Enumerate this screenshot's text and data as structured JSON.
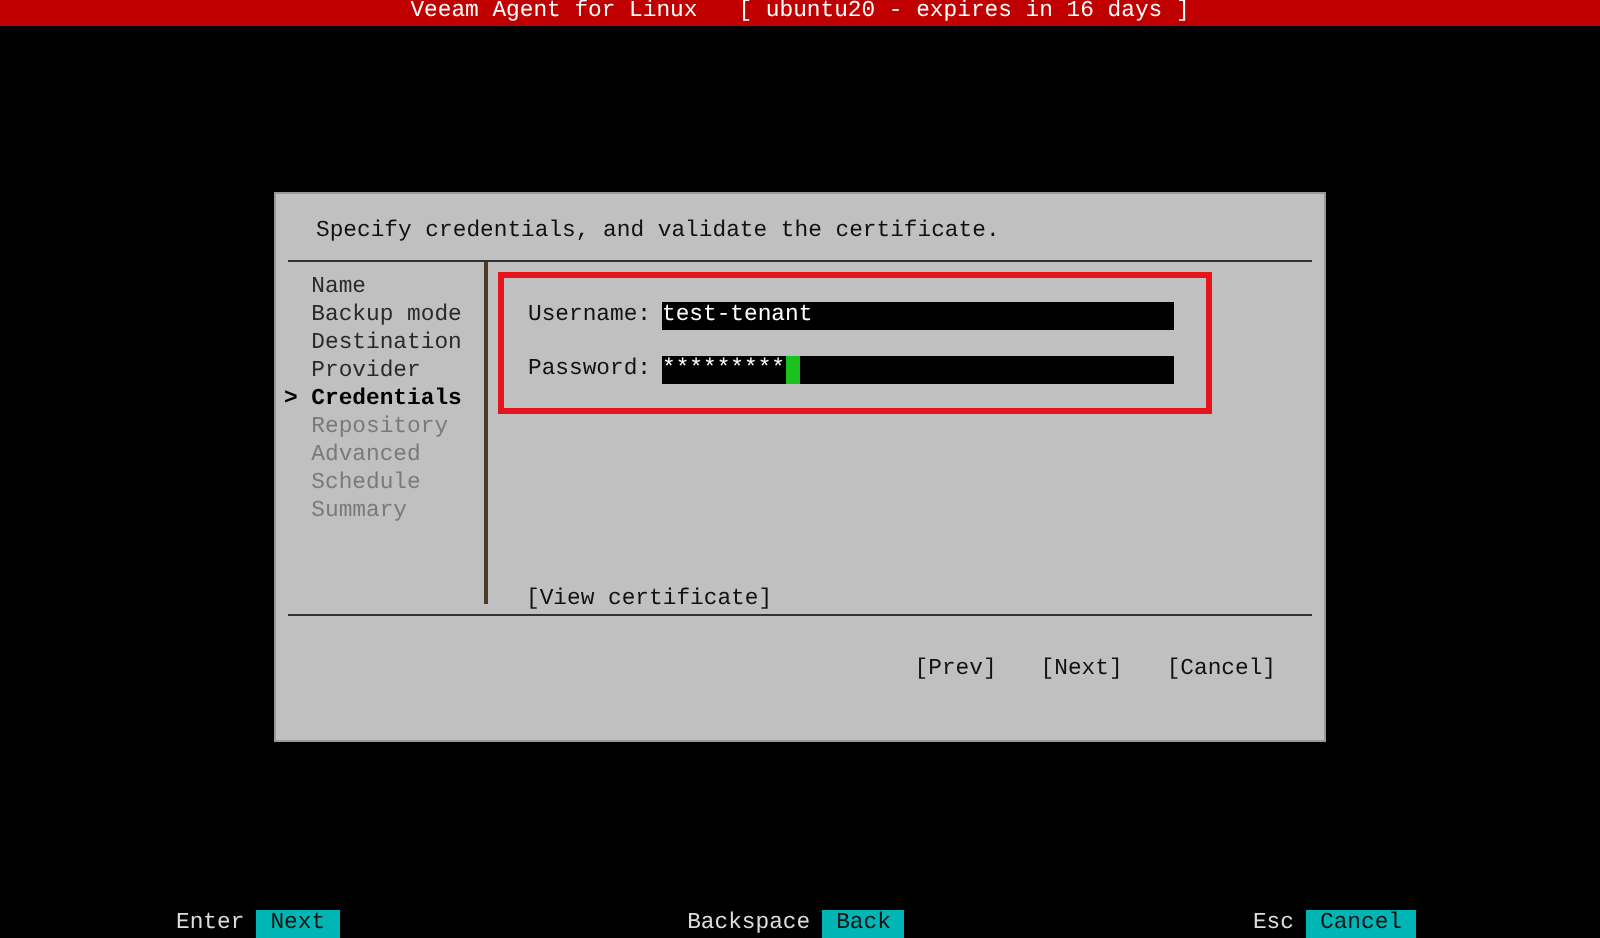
{
  "title_bar": {
    "title": "Veeam Agent for Linux   [ ubuntu20 - expires in 16 days ]"
  },
  "dialog": {
    "instruction": "Specify credentials, and validate the certificate.",
    "step_cursor": ">",
    "steps": [
      {
        "label": "Name",
        "selected": false,
        "disabled": false
      },
      {
        "label": "Backup mode",
        "selected": false,
        "disabled": false
      },
      {
        "label": "Destination",
        "selected": false,
        "disabled": false
      },
      {
        "label": "Provider",
        "selected": false,
        "disabled": false
      },
      {
        "label": "Credentials",
        "selected": true,
        "disabled": false
      },
      {
        "label": "Repository",
        "selected": false,
        "disabled": true
      },
      {
        "label": "Advanced",
        "selected": false,
        "disabled": true
      },
      {
        "label": "Schedule",
        "selected": false,
        "disabled": true
      },
      {
        "label": "Summary",
        "selected": false,
        "disabled": true
      }
    ],
    "credentials": {
      "highlighted": true,
      "fields": [
        {
          "label": "Username:",
          "value": "test-tenant",
          "focused": false
        },
        {
          "label": "Password:",
          "value": "*********",
          "focused": true
        }
      ]
    },
    "link": "[View certificate]",
    "buttons": [
      "[Prev]",
      "[Next]",
      "[Cancel]"
    ]
  },
  "key_hints": [
    {
      "key": "Enter",
      "action": "Next"
    },
    {
      "key": "Backspace",
      "action": "Back"
    },
    {
      "key": "Esc",
      "action": "Cancel"
    }
  ]
}
